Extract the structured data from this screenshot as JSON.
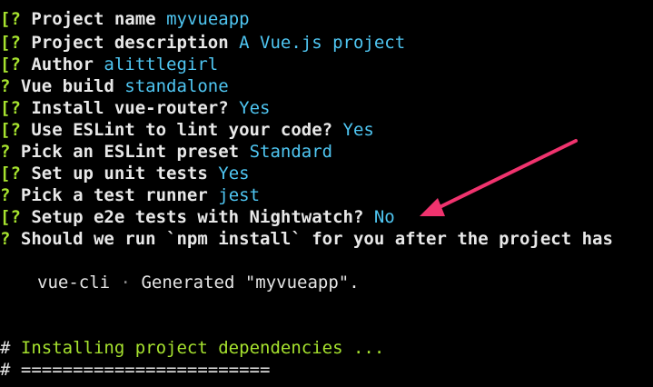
{
  "colors": {
    "background": "#000000",
    "question_mark": "#a6e22e",
    "prompt_text": "#e8e8e8",
    "answer": "#4fc6f2",
    "comment": "#a6e22e",
    "arrow": "#f0336e"
  },
  "prompts": [
    {
      "mark": "[?",
      "label": "Project name ",
      "answer": "myvueapp"
    },
    {
      "mark": "[?",
      "label": "Project description ",
      "answer": "A Vue.js project"
    },
    {
      "mark": "[?",
      "label": "Author ",
      "answer": "alittlegirl"
    },
    {
      "mark": "?",
      "label": "Vue build ",
      "answer": "standalone"
    },
    {
      "mark": "[?",
      "label": "Install vue-router? ",
      "answer": "Yes"
    },
    {
      "mark": "[?",
      "label": "Use ESLint to lint your code? ",
      "answer": "Yes"
    },
    {
      "mark": "?",
      "label": "Pick an ESLint preset ",
      "answer": "Standard"
    },
    {
      "mark": "[?",
      "label": "Set up unit tests ",
      "answer": "Yes"
    },
    {
      "mark": "?",
      "label": "Pick a test runner ",
      "answer": "jest"
    },
    {
      "mark": "[?",
      "label": "Setup e2e tests with Nightwatch? ",
      "answer": "No"
    },
    {
      "mark": "?",
      "label": "Should we run `npm install` for you after the project has",
      "answer": ""
    }
  ],
  "generated": {
    "tool": "vue-cli",
    "separator": "·",
    "message": "Generated \"myvueapp\"."
  },
  "installing": {
    "hash": "#",
    "text": "Installing project dependencies ...",
    "rule": "# ========================"
  },
  "annotation_icon": "arrow-pointer"
}
